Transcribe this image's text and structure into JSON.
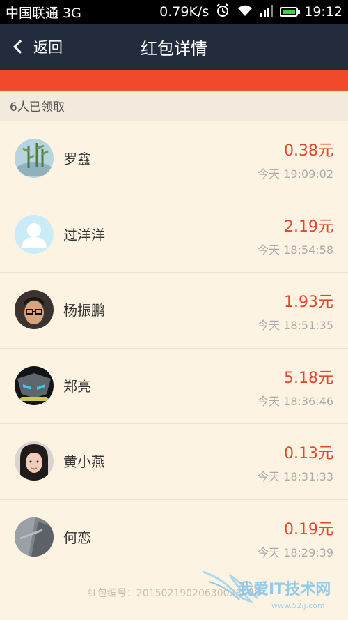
{
  "status_bar": {
    "carrier": "中国联通 3G",
    "speed": "0.79K/s",
    "time": "19:12"
  },
  "nav": {
    "back_label": "返回",
    "title": "红包详情"
  },
  "count_label": "6人已领取",
  "records": [
    {
      "name": "罗鑫",
      "amount": "0.38元",
      "time": "今天 19:09:02",
      "avatar_icon": "bamboo-photo-avatar"
    },
    {
      "name": "过洋洋",
      "amount": "2.19元",
      "time": "今天 18:54:58",
      "avatar_icon": "default-person-avatar"
    },
    {
      "name": "杨振鹏",
      "amount": "1.93元",
      "time": "今天 18:51:35",
      "avatar_icon": "glasses-man-photo-avatar"
    },
    {
      "name": "郑亮",
      "amount": "5.18元",
      "time": "今天 18:36:46",
      "avatar_icon": "robot-photo-avatar"
    },
    {
      "name": "黄小燕",
      "amount": "0.13元",
      "time": "今天 18:31:33",
      "avatar_icon": "woman-photo-avatar"
    },
    {
      "name": "何恋",
      "amount": "0.19元",
      "time": "今天 18:29:39",
      "avatar_icon": "grey-photo-avatar"
    }
  ],
  "footer": {
    "id_text": "红包编号：20150219020630028436"
  },
  "watermark": {
    "text": "我爱IT技术网",
    "site": "www.52ij.com"
  },
  "colors": {
    "nav_bg": "#232c3d",
    "red_band": "#ef4a2c",
    "amount": "#e8442a",
    "background": "#fdf3e3"
  }
}
